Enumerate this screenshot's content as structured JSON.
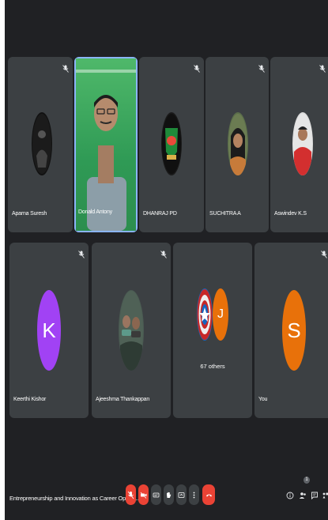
{
  "meeting": {
    "title": "Entrepreneurship and Innovation as Career Opport...",
    "others_label": "67 others",
    "hand_count": "1"
  },
  "participants": [
    {
      "name": "Aparna Suresh",
      "muted": true
    },
    {
      "name": "Donald Antony",
      "speaking": true
    },
    {
      "name": "DHANRAJ PD",
      "muted": true
    },
    {
      "name": "SUCHITRA A",
      "muted": true
    },
    {
      "name": "Aswindev K.S",
      "muted": true
    },
    {
      "name": "Keerthi Kishor",
      "letter": "K",
      "color": "#a142f4",
      "muted": true
    },
    {
      "name": "Ajeeshma Thankappan",
      "muted": true
    },
    {
      "name": "You",
      "letter": "S",
      "color": "#e8710a",
      "muted": true
    }
  ],
  "others_avatar_letter": "J",
  "colors": {
    "background": "#202124",
    "tile": "#3c4043",
    "end_call": "#ea4335",
    "accent": "#8ab4f8",
    "orange": "#e8710a",
    "purple": "#a142f4"
  },
  "controls": [
    "mic-off-icon",
    "camera-off-icon",
    "captions-icon",
    "raise-hand-icon",
    "present-icon",
    "more-icon",
    "end-call-icon"
  ]
}
